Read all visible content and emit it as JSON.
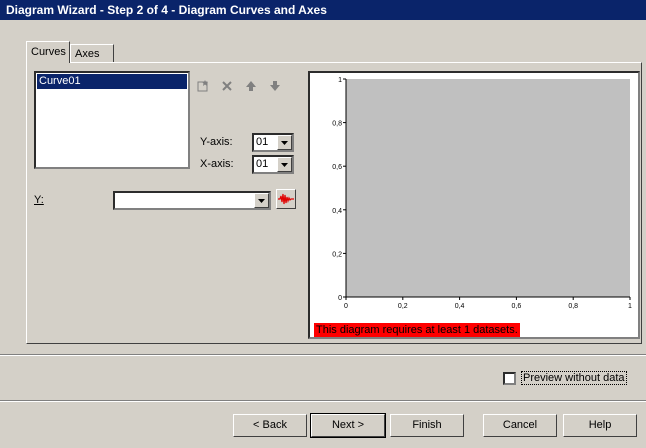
{
  "window": {
    "title": "Diagram Wizard - Step 2 of 4 - Diagram Curves and Axes"
  },
  "tabs": [
    {
      "label": "Curves",
      "active": true
    },
    {
      "label": "Axes",
      "active": false
    }
  ],
  "curves": {
    "items": [
      "Curve01"
    ],
    "selected": "Curve01"
  },
  "toolbar": {
    "icons": [
      "new-icon",
      "delete-icon",
      "move-up-icon",
      "move-down-icon"
    ]
  },
  "y_axis": {
    "label": "Y-axis:",
    "value": "01"
  },
  "x_axis": {
    "label": "X-axis:",
    "value": "01"
  },
  "y_field": {
    "label": "Y:",
    "value": ""
  },
  "preview": {
    "y_ticks": [
      "1",
      "0,8",
      "0,6",
      "0,4",
      "0,2",
      "0"
    ],
    "x_ticks": [
      "0",
      "0,2",
      "0,4",
      "0,6",
      "0,8",
      "1"
    ],
    "plot_bg": "#c0c0c0",
    "warning": "This diagram requires at least 1 datasets.",
    "warning_color": "#ff0000"
  },
  "preview_without_data": {
    "label": "Preview without data",
    "checked": false
  },
  "buttons": {
    "back": "< Back",
    "next": "Next >",
    "finish": "Finish",
    "cancel": "Cancel",
    "help": "Help"
  },
  "colors": {
    "title_bar": "#0a246a",
    "selection": "#0a246a",
    "dialog_bg": "#d4d0c8"
  }
}
